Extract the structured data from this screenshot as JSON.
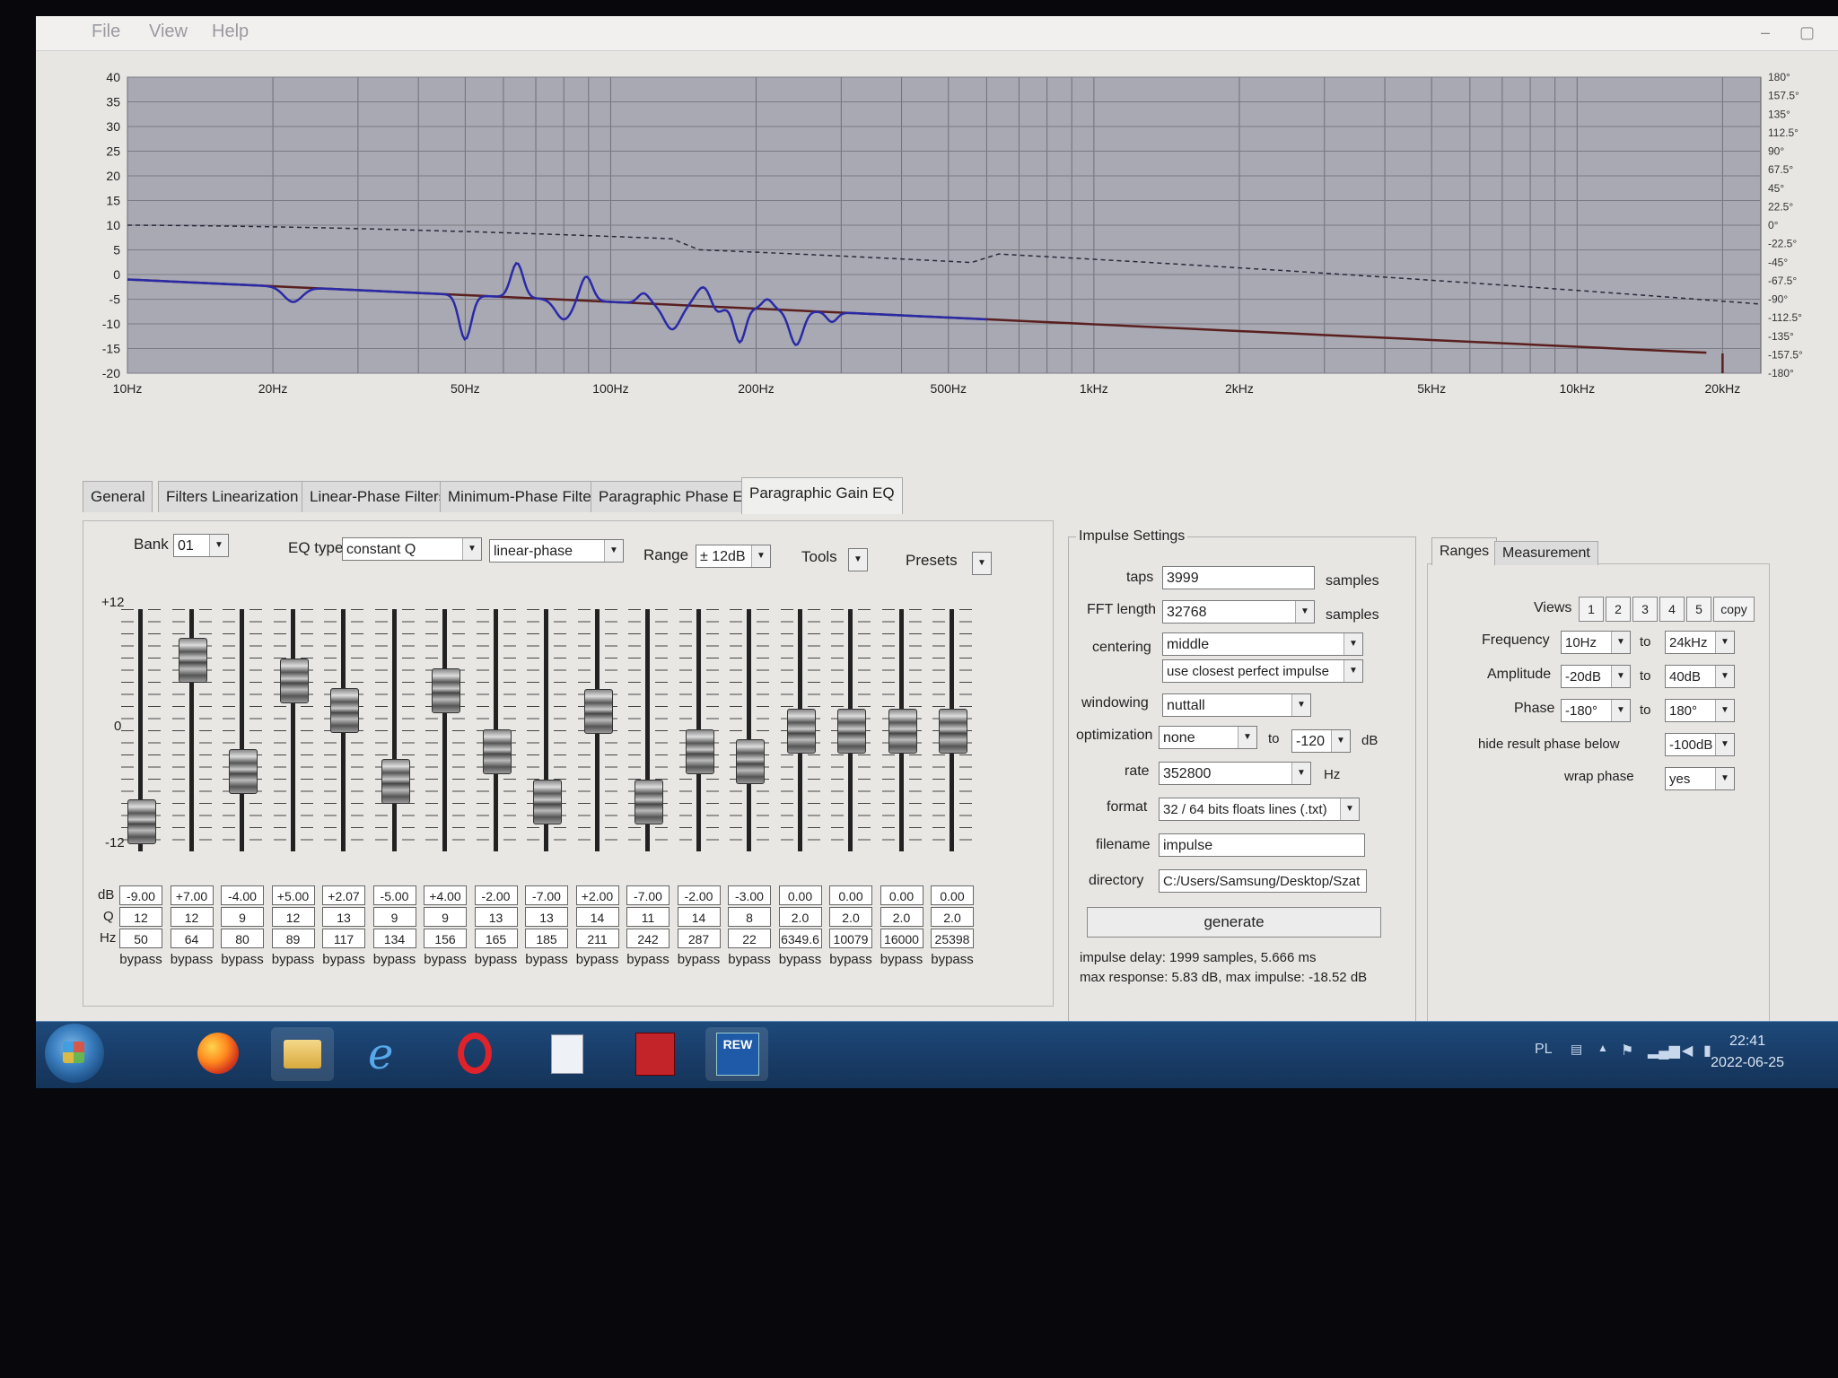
{
  "menu": [
    "File",
    "View",
    "Help"
  ],
  "graph": {
    "y_ticks": [
      "40",
      "35",
      "30",
      "25",
      "20",
      "15",
      "10",
      "5",
      "0",
      "-5",
      "-10",
      "-15",
      "-20"
    ],
    "x_ticks": [
      "10Hz",
      "20Hz",
      "50Hz",
      "100Hz",
      "200Hz",
      "500Hz",
      "1kHz",
      "2kHz",
      "5kHz",
      "10kHz",
      "20kHz"
    ],
    "phase_ticks": [
      "180°",
      "157.5°",
      "135°",
      "112.5°",
      "90°",
      "67.5°",
      "45°",
      "22.5°",
      "0°",
      "-22.5°",
      "-45°",
      "-67.5°",
      "-90°",
      "-112.5°",
      "-135°",
      "-157.5°",
      "-180°"
    ],
    "colors": {
      "plot_bg": "#a8a9b3",
      "response": "#2a2aa8",
      "target": "#5a1f1f",
      "phase": "#2a2a3a"
    },
    "y_range_db": [
      -20,
      40
    ],
    "x_range_hz": [
      10,
      24000
    ]
  },
  "tabs": [
    "General",
    "Filters Linearization",
    "Linear-Phase Filters",
    "Minimum-Phase Filters",
    "Paragraphic Phase EQ",
    "Paragraphic Gain EQ"
  ],
  "active_tab": "Paragraphic Gain EQ",
  "eq": {
    "bank_label": "Bank",
    "bank_value": "01",
    "eq_type_label": "EQ type",
    "eq_type_value": "constant Q",
    "phase_mode_value": "linear-phase",
    "range_label": "Range",
    "range_value": "± 12dB",
    "tools_label": "Tools",
    "presets_label": "Presets",
    "scale_top": "+12",
    "scale_mid": "0",
    "scale_bottom": "-12",
    "row_db": "dB",
    "row_q": "Q",
    "row_hz": "Hz",
    "bands": [
      {
        "db": "-9.00",
        "q": "12",
        "hz": "50",
        "bypass": "bypass",
        "gain": -9
      },
      {
        "db": "+7.00",
        "q": "12",
        "hz": "64",
        "bypass": "bypass",
        "gain": 7
      },
      {
        "db": "-4.00",
        "q": "9",
        "hz": "80",
        "bypass": "bypass",
        "gain": -4
      },
      {
        "db": "+5.00",
        "q": "12",
        "hz": "89",
        "bypass": "bypass",
        "gain": 5
      },
      {
        "db": "+2.07",
        "q": "13",
        "hz": "117",
        "bypass": "bypass",
        "gain": 2.07
      },
      {
        "db": "-5.00",
        "q": "9",
        "hz": "134",
        "bypass": "bypass",
        "gain": -5
      },
      {
        "db": "+4.00",
        "q": "9",
        "hz": "156",
        "bypass": "bypass",
        "gain": 4
      },
      {
        "db": "-2.00",
        "q": "13",
        "hz": "165",
        "bypass": "bypass",
        "gain": -2
      },
      {
        "db": "-7.00",
        "q": "13",
        "hz": "185",
        "bypass": "bypass",
        "gain": -7
      },
      {
        "db": "+2.00",
        "q": "14",
        "hz": "211",
        "bypass": "bypass",
        "gain": 2
      },
      {
        "db": "-7.00",
        "q": "11",
        "hz": "242",
        "bypass": "bypass",
        "gain": -7
      },
      {
        "db": "-2.00",
        "q": "14",
        "hz": "287",
        "bypass": "bypass",
        "gain": -2
      },
      {
        "db": "-3.00",
        "q": "8",
        "hz": "22",
        "bypass": "bypass",
        "gain": -3
      },
      {
        "db": "0.00",
        "q": "2.0",
        "hz": "6349.6",
        "bypass": "bypass",
        "gain": 0
      },
      {
        "db": "0.00",
        "q": "2.0",
        "hz": "10079",
        "bypass": "bypass",
        "gain": 0
      },
      {
        "db": "0.00",
        "q": "2.0",
        "hz": "16000",
        "bypass": "bypass",
        "gain": 0
      },
      {
        "db": "0.00",
        "q": "2.0",
        "hz": "25398",
        "bypass": "bypass",
        "gain": 0
      }
    ]
  },
  "impulse": {
    "group_label": "Impulse Settings",
    "taps_label": "taps",
    "taps_value": "3999",
    "taps_unit": "samples",
    "fft_label": "FFT length",
    "fft_value": "32768",
    "fft_unit": "samples",
    "centering_label": "centering",
    "centering_value": "middle",
    "centering_mode": "use closest perfect impulse",
    "windowing_label": "windowing",
    "windowing_value": "nuttall",
    "optimization_label": "optimization",
    "optimization_value": "none",
    "optimization_to": "to",
    "optimization_db_value": "-120",
    "optimization_unit": "dB",
    "rate_label": "rate",
    "rate_value": "352800",
    "rate_unit": "Hz",
    "format_label": "format",
    "format_value": "32 / 64 bits floats lines (.txt)",
    "filename_label": "filename",
    "filename_value": "impulse",
    "directory_label": "directory",
    "directory_value": "C:/Users/Samsung/Desktop/Szat",
    "generate_label": "generate",
    "delay_note": "impulse delay: 1999 samples, 5.666 ms",
    "response_note": "max response: 5.83 dB, max impulse: -18.52 dB"
  },
  "ranges": {
    "tab_ranges": "Ranges",
    "tab_measurement": "Measurement",
    "views_label": "Views",
    "views": [
      "1",
      "2",
      "3",
      "4",
      "5",
      "copy"
    ],
    "frequency_label": "Frequency",
    "frequency_from": "10Hz",
    "frequency_to": "24kHz",
    "amplitude_label": "Amplitude",
    "amplitude_from": "-20dB",
    "amplitude_to": "40dB",
    "phase_label": "Phase",
    "phase_from": "-180°",
    "phase_to": "180°",
    "to_label": "to",
    "hide_label": "hide result phase below",
    "hide_value": "-100dB",
    "wrap_label": "wrap phase",
    "wrap_value": "yes"
  },
  "taskbar": {
    "apps": [
      "start-orb-icon",
      "firefox-icon",
      "file-explorer-icon",
      "internet-explorer-icon",
      "opera-icon",
      "notepad-icon",
      "red-app-icon",
      "rew-icon"
    ],
    "rew_label": "REW",
    "lang": "PL",
    "time": "22:41",
    "date": "2022-06-25"
  }
}
